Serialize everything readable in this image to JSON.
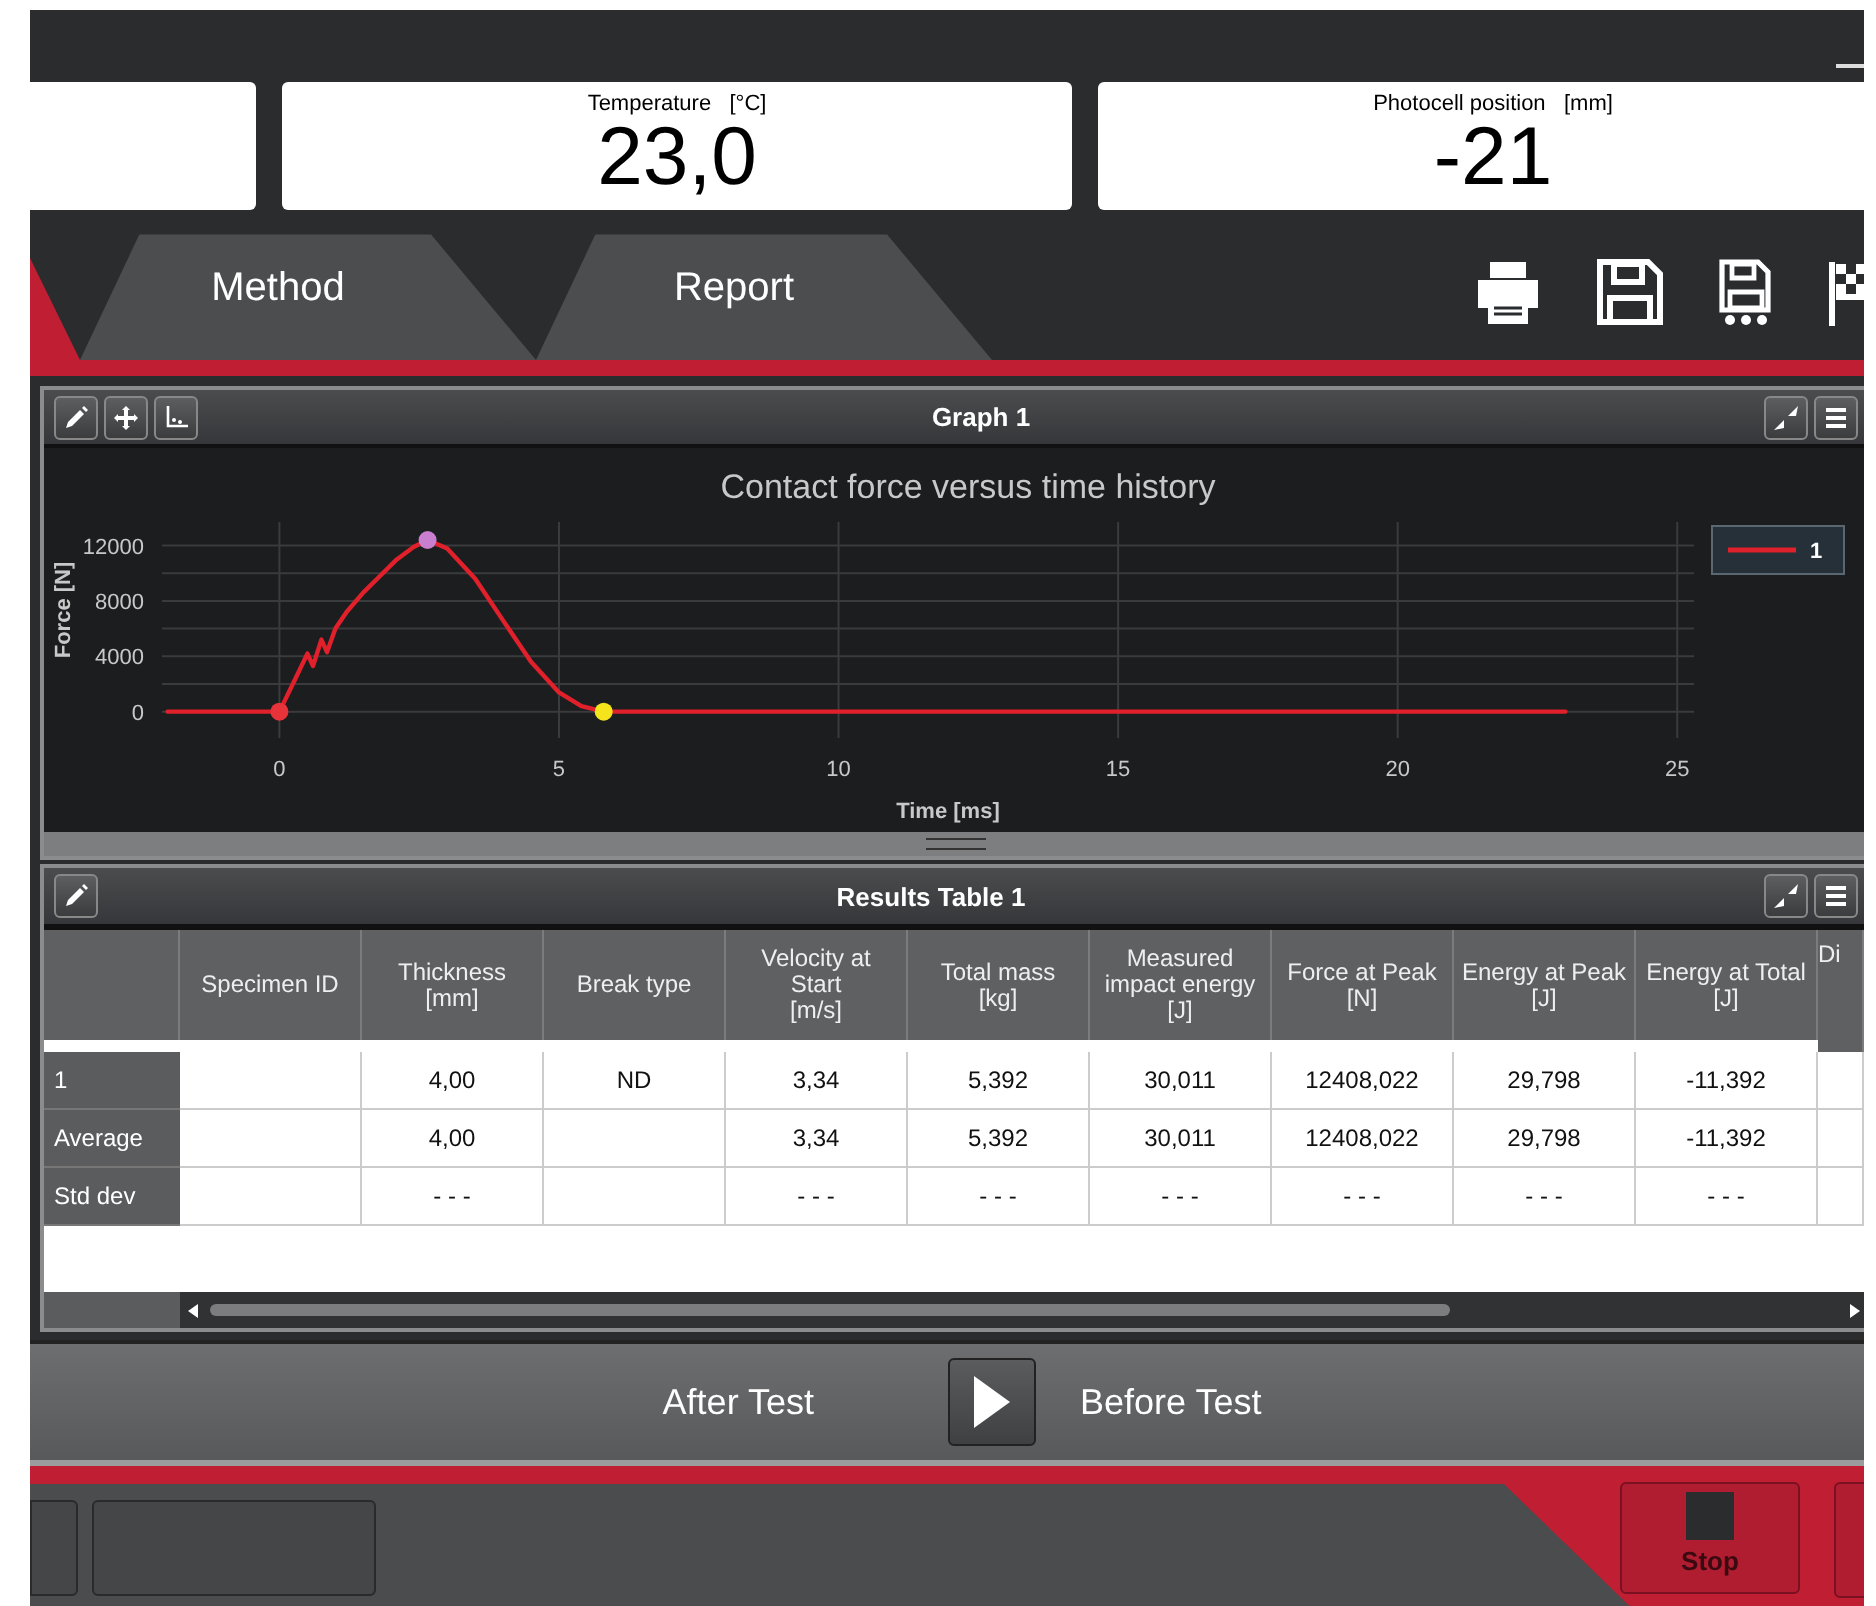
{
  "readouts": [
    {
      "label": "Temperature",
      "unit": "[°C]",
      "value": "23,0"
    },
    {
      "label": "Photocell position",
      "unit": "[mm]",
      "value": "-21"
    }
  ],
  "tabs": [
    {
      "label": "Method",
      "selected": false
    },
    {
      "label": "Report",
      "selected": false
    }
  ],
  "graph_panel": {
    "title": "Graph 1",
    "chart_data": {
      "type": "line",
      "title": "Contact force versus time history",
      "xlabel": "Time [ms]",
      "ylabel": "Force [N]",
      "x": [
        -2,
        0,
        0.3,
        0.5,
        0.6,
        0.75,
        0.85,
        1.0,
        1.2,
        1.5,
        1.8,
        2.1,
        2.4,
        2.65,
        3.0,
        3.5,
        4.0,
        4.5,
        5.0,
        5.4,
        5.8,
        10,
        15,
        20,
        23
      ],
      "series": [
        {
          "name": "1",
          "color": "#e0202a",
          "values": [
            0,
            0,
            2500,
            4200,
            3300,
            5200,
            4300,
            6000,
            7200,
            8600,
            9800,
            11000,
            11900,
            12400,
            11800,
            9600,
            6600,
            3600,
            1400,
            400,
            0,
            0,
            0,
            0,
            0
          ]
        }
      ],
      "xlim": [
        -2.1,
        25.3
      ],
      "ylim": [
        -1900,
        13700
      ],
      "xticks": [
        0,
        5,
        10,
        15,
        20,
        25
      ],
      "yticks": [
        0,
        4000,
        8000,
        12000
      ],
      "grid": true
    }
  },
  "results_panel": {
    "title": "Results Table 1",
    "table": {
      "columns": [
        "Specimen ID",
        "Thickness\n[mm]",
        "Break type",
        "Velocity at\nStart\n[m/s]",
        "Total mass\n[kg]",
        "Measured\nimpact energy\n[J]",
        "Force at Peak\n[N]",
        "Energy at Peak\n[J]",
        "Energy at Total\n[J]",
        "Di"
      ],
      "rows": [
        {
          "label": "1",
          "cells": [
            "",
            "4,00",
            "ND",
            "3,34",
            "5,392",
            "30,011",
            "12408,022",
            "29,798",
            "-11,392",
            ""
          ]
        },
        {
          "label": "Average",
          "cells": [
            "",
            "4,00",
            "",
            "3,34",
            "5,392",
            "30,011",
            "12408,022",
            "29,798",
            "-11,392",
            ""
          ]
        },
        {
          "label": "Std dev",
          "cells": [
            "",
            "- - -",
            "",
            "- - -",
            "- - -",
            "- - -",
            "- - -",
            "- - -",
            "- - -",
            ""
          ]
        }
      ]
    }
  },
  "navigation": {
    "previous": "After Test",
    "next": "Before Test"
  },
  "bottom_bar": {
    "stop_label": "Stop"
  }
}
